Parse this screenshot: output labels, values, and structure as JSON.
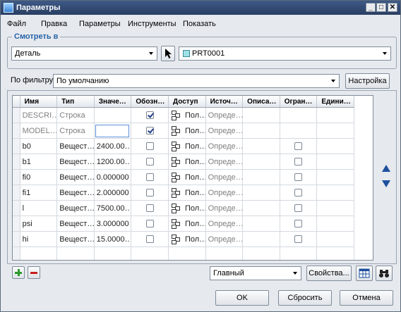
{
  "window": {
    "title": "Параметры",
    "min": "_",
    "max": "□",
    "close": "✕"
  },
  "menu": [
    "Файл",
    "Правка",
    "Параметры",
    "Инструменты",
    "Показать"
  ],
  "look_in": {
    "legend": "Смотреть в",
    "type_value": "Деталь",
    "model_value": "PRT0001"
  },
  "filter": {
    "label": "По фильтру",
    "value": "По умолчанию",
    "setup_button": "Настройка"
  },
  "table": {
    "columns": [
      "Имя",
      "Тип",
      "Значе…",
      "Обозн…",
      "Доступ",
      "Источ…",
      "Описа…",
      "Огран…",
      "Едини…"
    ],
    "rows": [
      {
        "name": "DESCRI…",
        "type": "Строка",
        "value": "",
        "designate": true,
        "access": "Пол…",
        "source": "Опреде…",
        "restricted": null,
        "readonly": true
      },
      {
        "name": "MODEL…",
        "type": "Строка",
        "value": "",
        "designate": true,
        "access": "Пол…",
        "source": "Опреде…",
        "restricted": null,
        "readonly": true,
        "editing": true
      },
      {
        "name": "b0",
        "type": "Вещест…",
        "value": "2400.00…",
        "designate": false,
        "access": "Пол…",
        "source": "Опреде…",
        "restricted": false
      },
      {
        "name": "b1",
        "type": "Вещест…",
        "value": "1200.00…",
        "designate": false,
        "access": "Пол…",
        "source": "Опреде…",
        "restricted": false
      },
      {
        "name": "fi0",
        "type": "Вещест…",
        "value": "0.000000",
        "designate": false,
        "access": "Пол…",
        "source": "Опреде…",
        "restricted": false
      },
      {
        "name": "fi1",
        "type": "Вещест…",
        "value": "2.000000",
        "designate": false,
        "access": "Пол…",
        "source": "Опреде…",
        "restricted": false
      },
      {
        "name": "l",
        "type": "Вещест…",
        "value": "7500.00…",
        "designate": false,
        "access": "Пол…",
        "source": "Опреде…",
        "restricted": false
      },
      {
        "name": "psi",
        "type": "Вещест…",
        "value": "3.000000",
        "designate": false,
        "access": "Пол…",
        "source": "Опреде…",
        "restricted": false
      },
      {
        "name": "hi",
        "type": "Вещест…",
        "value": "15.0000…",
        "designate": false,
        "access": "Пол…",
        "source": "Опреде…",
        "restricted": false
      }
    ]
  },
  "bottom": {
    "main_value": "Главный",
    "properties_button": "Свойства...",
    "ok_button": "OK",
    "reset_button": "Сбросить",
    "cancel_button": "Отмена"
  }
}
